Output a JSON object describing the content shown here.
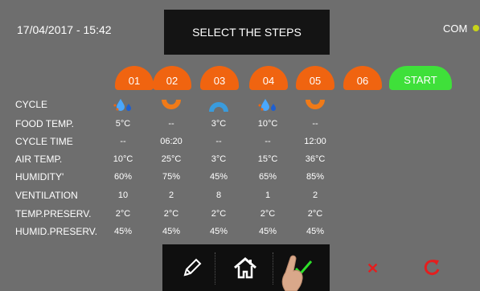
{
  "header": {
    "datetime": "17/04/2017 - 15:42",
    "title": "SELECT THE STEPS",
    "com_label": "COM",
    "com_status_color": "#c8d41a"
  },
  "steps": [
    {
      "label": "01",
      "cycle_icon": "cool-drops-icon"
    },
    {
      "label": "02",
      "cycle_icon": "bowl-orange-icon"
    },
    {
      "label": "03",
      "cycle_icon": "arch-blue-icon"
    },
    {
      "label": "04",
      "cycle_icon": "cool-drops-icon"
    },
    {
      "label": "05",
      "cycle_icon": "bowl-orange-icon"
    },
    {
      "label": "06"
    }
  ],
  "start_label": "START",
  "rows": [
    {
      "label": "CYCLE"
    },
    {
      "label": "FOOD TEMP.",
      "values": [
        "5°C",
        "--",
        "3°C",
        "10°C",
        "--"
      ]
    },
    {
      "label": "CYCLE TIME",
      "values": [
        "--",
        "06:20",
        "--",
        "--",
        "12:00"
      ]
    },
    {
      "label": "AIR TEMP.",
      "values": [
        "10°C",
        "25°C",
        "3°C",
        "15°C",
        "36°C"
      ]
    },
    {
      "label": "HUMIDITY'",
      "values": [
        "60%",
        "75%",
        "45%",
        "65%",
        "85%"
      ]
    },
    {
      "label": "VENTILATION",
      "values": [
        "10",
        "2",
        "8",
        "1",
        "2"
      ]
    },
    {
      "label": "TEMP.PRESERV.",
      "values": [
        "2°C",
        "2°C",
        "2°C",
        "2°C",
        "2°C"
      ]
    },
    {
      "label": "HUMID.PRESERV.",
      "values": [
        "45%",
        "45%",
        "45%",
        "45%",
        "45%"
      ]
    }
  ],
  "toolbar": {
    "icons": [
      "pencil-icon",
      "home-icon",
      "checkmark-icon"
    ],
    "cancel_icon": "x-icon",
    "redo_icon": "redo-icon"
  },
  "colors": {
    "background": "#6e6e6e",
    "step_orange": "#f06410",
    "start_green": "#3fe03a",
    "cancel_red": "#e41e1e"
  }
}
